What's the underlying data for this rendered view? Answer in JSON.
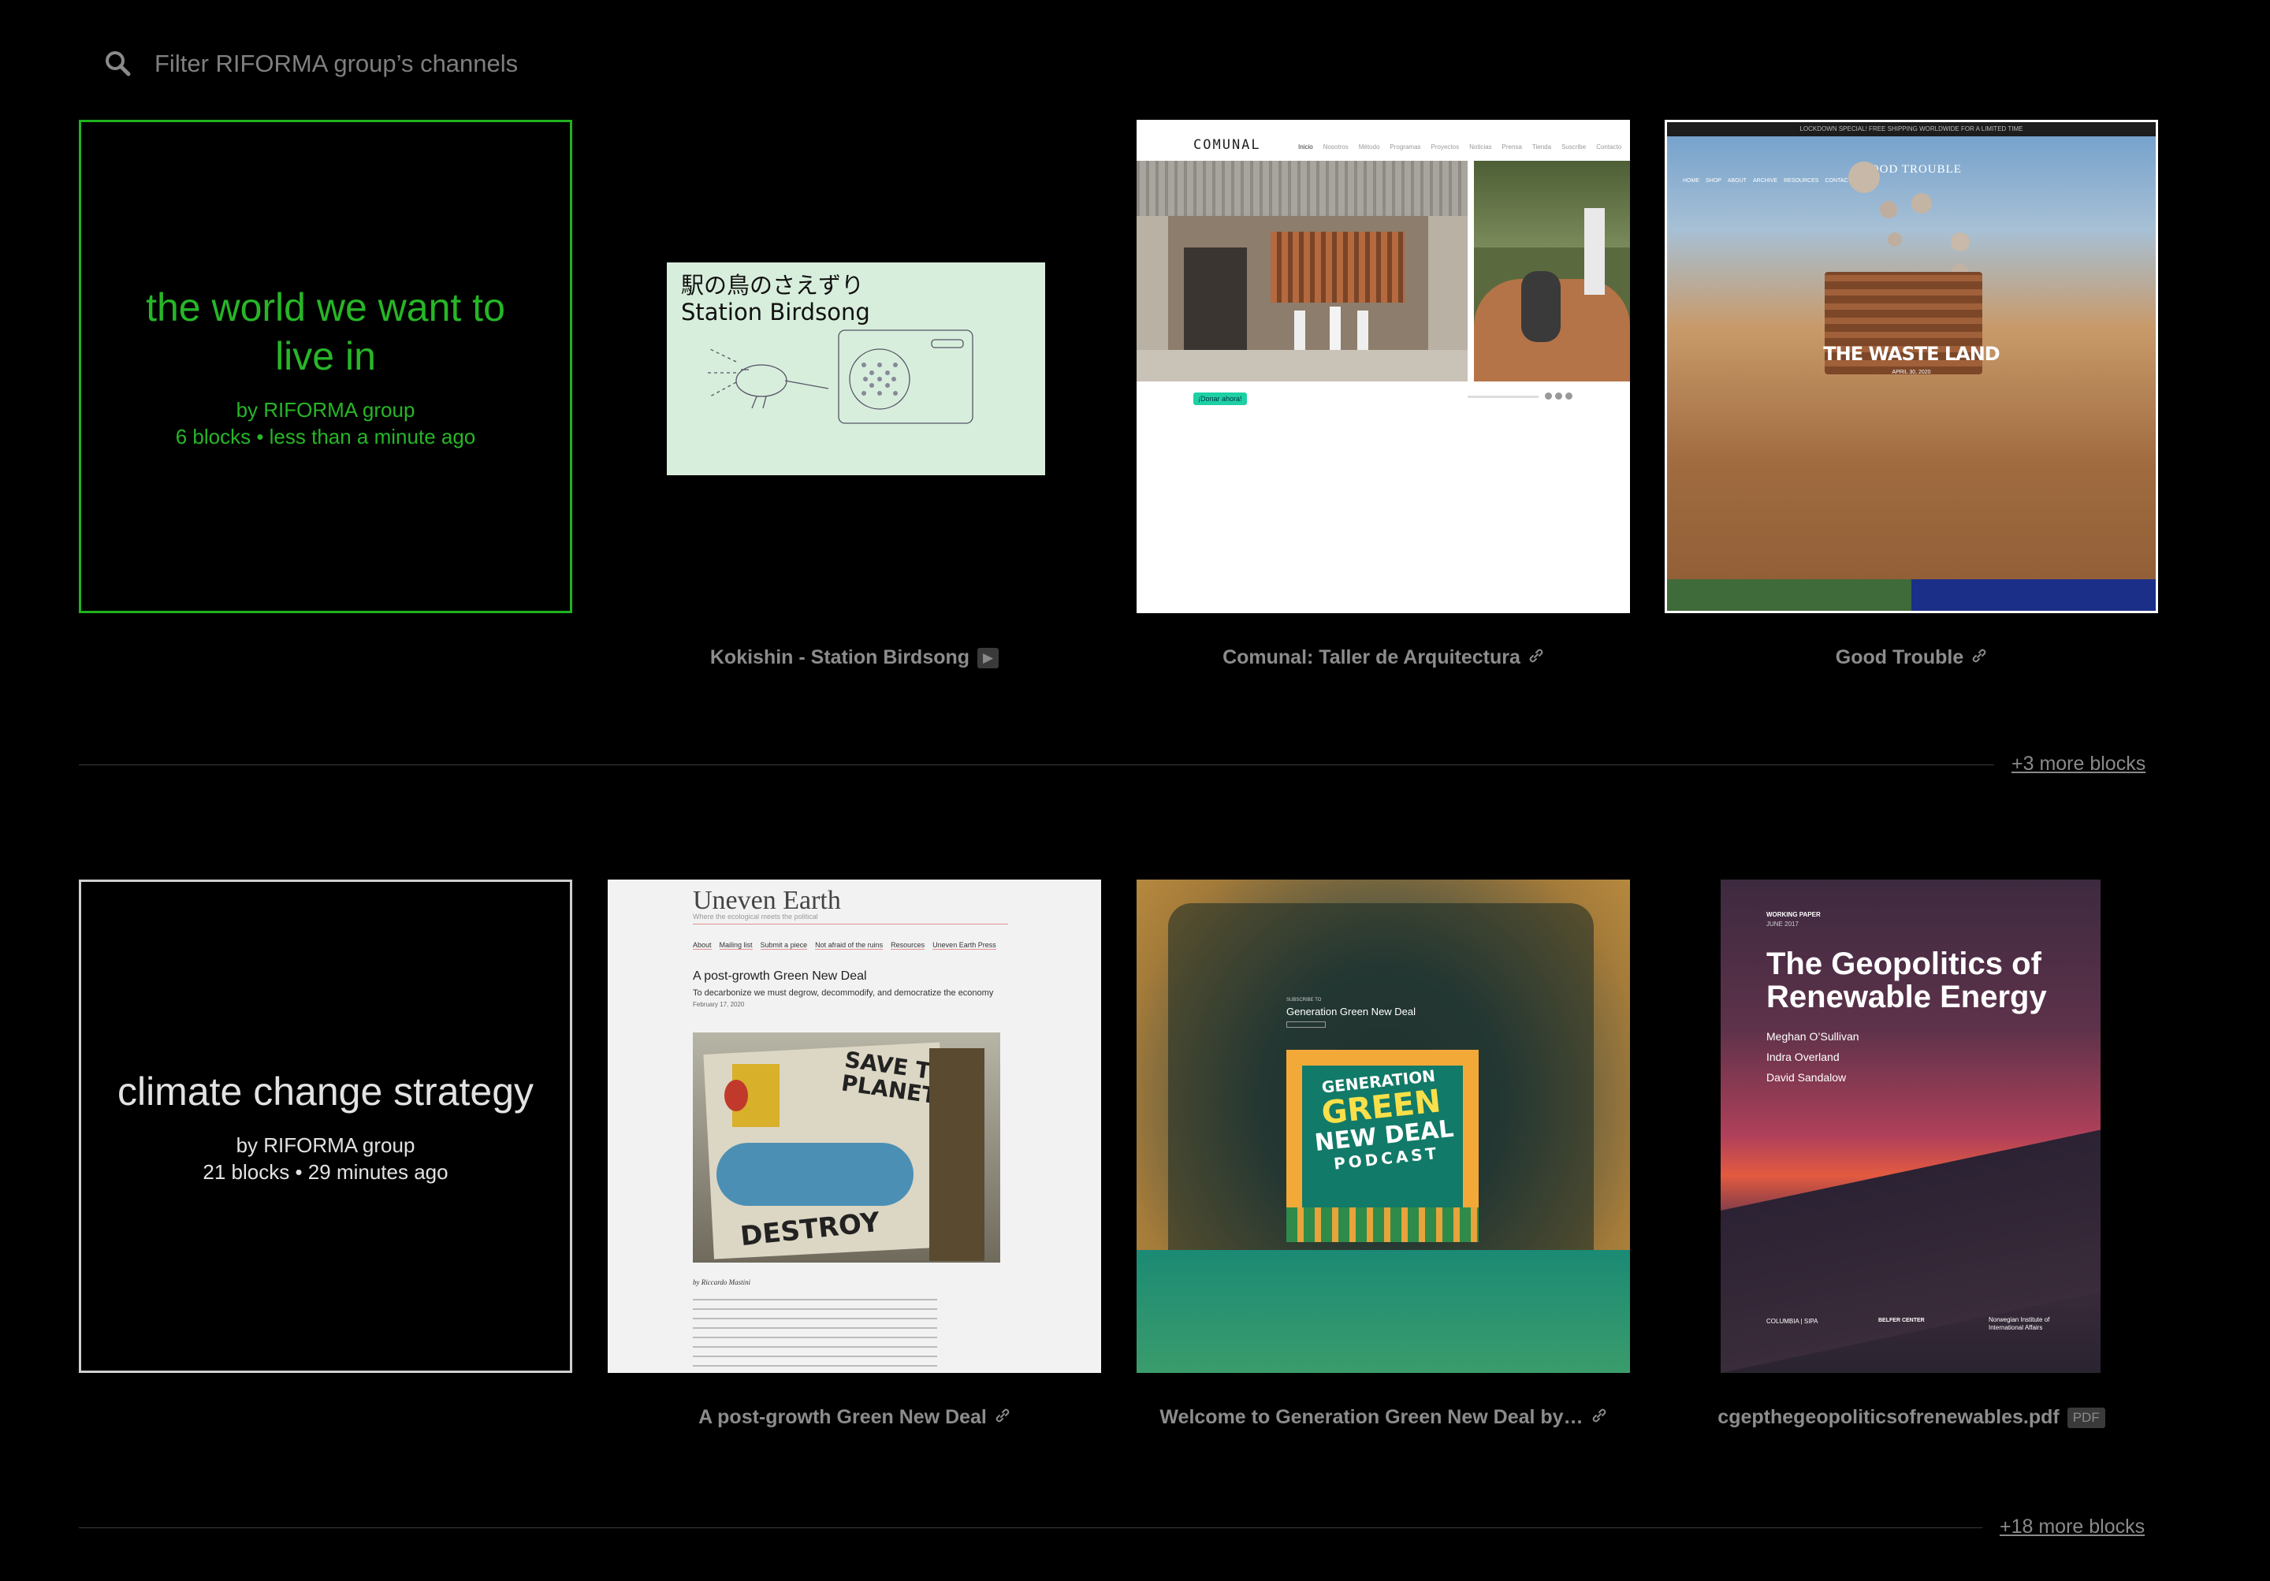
{
  "search": {
    "placeholder": "Filter RIFORMA group’s channels",
    "icon": "search-icon"
  },
  "rows": [
    {
      "channel": {
        "title": "the world we want to live in",
        "author": "by RIFORMA group",
        "stats": "6 blocks • less than a minute ago",
        "color": "#27b627"
      },
      "blocks": [
        {
          "caption": "Kokishin - Station Birdsong",
          "badge": "▶",
          "thumb": {
            "title_jp": "駅の鳥のさえずり",
            "title_en": "Station Birdsong"
          }
        },
        {
          "caption": "Comunal: Taller de Arquitectura",
          "badge": "🔗",
          "thumb": {
            "logo": "COMUNAL",
            "nav": [
              "Inicio",
              "Nosotros",
              "Método",
              "Programas",
              "Proyectos",
              "Noticias",
              "Prensa",
              "Tienda",
              "Suscribe",
              "Contacto"
            ],
            "button": "¡Donar ahora!"
          }
        },
        {
          "caption": "Good Trouble",
          "badge": "🔗",
          "thumb": {
            "banner": "LOCKDOWN SPECIAL! FREE SHIPPING WORLDWIDE FOR A LIMITED TIME",
            "logo": "GOOD TROUBLE",
            "nav": [
              "HOME",
              "SHOP",
              "ABOUT",
              "ARCHIVE",
              "RESOURCES",
              "CONTACT"
            ],
            "headline": "THE WASTE LAND",
            "date": "APRIL 30, 2020"
          }
        }
      ],
      "more": "+3 more blocks"
    },
    {
      "channel": {
        "title": "climate change strategy",
        "author": "by RIFORMA group",
        "stats": "21 blocks • 29 minutes ago",
        "color": "#e2e2e2"
      },
      "blocks": [
        {
          "caption": "A post-growth Green New Deal",
          "badge": "🔗",
          "thumb": {
            "site": "Uneven Earth",
            "tagline": "Where the ecological meets the political",
            "nav": [
              "About",
              "Mailing list",
              "Submit a piece",
              "Not afraid of the ruins",
              "Resources",
              "Uneven Earth Press"
            ],
            "headline": "A post-growth Green New Deal",
            "subhead": "To decarbonize we must degrow, decommodify, and democratize the economy",
            "date": "February 17, 2020",
            "byline": "by Riccardo Mastini"
          }
        },
        {
          "caption": "Welcome to Generation Green New Deal by…",
          "badge": "🔗",
          "thumb": {
            "kicker": "SUBSCRIBE TO",
            "title": "Generation Green New Deal",
            "art_lines": [
              "GENERATION",
              "GREEN",
              "NEW DEAL",
              "PODCAST"
            ]
          }
        },
        {
          "caption": "cgepthegeopoliticsofrenewables.pdf",
          "badge": "PDF",
          "thumb": {
            "kicker": "WORKING PAPER",
            "date": "JUNE 2017",
            "title": "The Geopolitics of Renewable Energy",
            "authors": [
              "Meghan O’Sullivan",
              "Indra Overland",
              "David Sandalow"
            ],
            "logos": [
              "COLUMBIA | SIPA",
              "BELFER CENTER",
              "Norwegian Institute of International Affairs"
            ]
          }
        }
      ],
      "more": "+18 more blocks"
    }
  ]
}
